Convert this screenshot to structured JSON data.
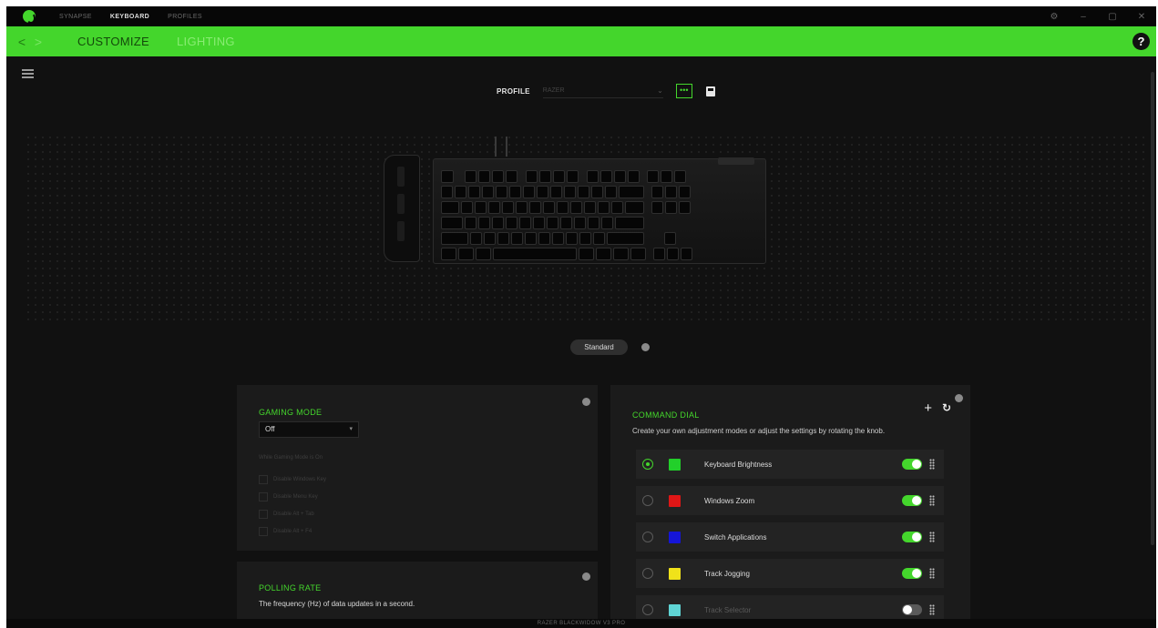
{
  "titlebar": {
    "tabs": [
      {
        "label": "SYNAPSE"
      },
      {
        "label": "KEYBOARD"
      },
      {
        "label": "PROFILES"
      }
    ]
  },
  "subbar": {
    "tabs": [
      {
        "label": "CUSTOMIZE"
      },
      {
        "label": "LIGHTING"
      }
    ],
    "help_label": "?"
  },
  "profile": {
    "label": "PROFILE",
    "value": "RAZER",
    "more_label": "•••"
  },
  "modes": {
    "active_label": "Standard"
  },
  "gaming_mode": {
    "title": "GAMING MODE",
    "select_value": "Off",
    "caption": "While Gaming Mode is On",
    "options": [
      {
        "label": "Disable Windows Key"
      },
      {
        "label": "Disable Menu Key"
      },
      {
        "label": "Disable Alt + Tab"
      },
      {
        "label": "Disable Alt + F4"
      }
    ]
  },
  "polling_rate": {
    "title": "POLLING RATE",
    "description": "The frequency (Hz) of data updates in a second."
  },
  "command_dial": {
    "title": "COMMAND DIAL",
    "add_label": "+",
    "reset_label": "↻",
    "description": "Create your own adjustment modes or adjust the settings by rotating the knob.",
    "items": [
      {
        "label": "Keyboard Brightness",
        "color": "#22d02a",
        "selected": true,
        "enabled": true
      },
      {
        "label": "Windows Zoom",
        "color": "#e01616",
        "selected": false,
        "enabled": true
      },
      {
        "label": "Switch Applications",
        "color": "#1515d8",
        "selected": false,
        "enabled": true
      },
      {
        "label": "Track Jogging",
        "color": "#f0e21a",
        "selected": false,
        "enabled": true
      },
      {
        "label": "Track Selector",
        "color": "#5fd4d4",
        "selected": false,
        "enabled": false
      }
    ]
  },
  "statusbar": {
    "device": "RAZER BLACKWIDOW V3 PRO"
  },
  "colors": {
    "accent": "#44d62c",
    "background": "#111111",
    "panel": "#1b1b1b"
  }
}
